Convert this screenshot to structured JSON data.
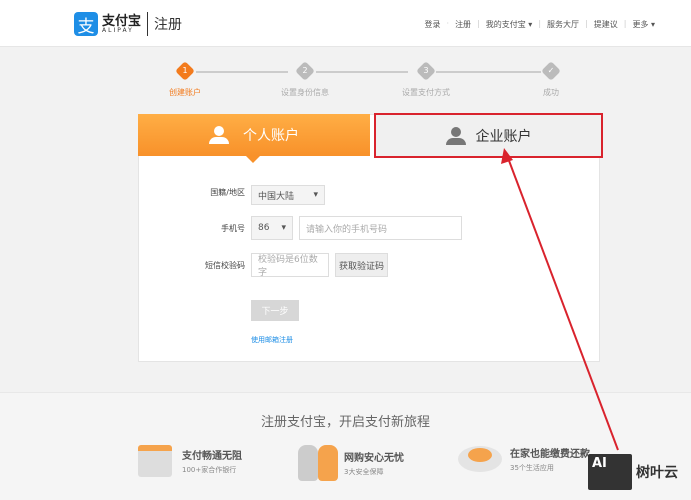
{
  "header": {
    "logo_cn": "支付宝",
    "logo_en": "ALIPAY",
    "page_title": "注册",
    "nav": [
      "登录",
      "注册",
      "我的支付宝",
      "服务大厅",
      "提建议",
      "更多"
    ]
  },
  "steps": [
    {
      "num": "1",
      "label": "创建账户"
    },
    {
      "num": "2",
      "label": "设置身份信息"
    },
    {
      "num": "3",
      "label": "设置支付方式"
    },
    {
      "num": "✓",
      "label": "成功"
    }
  ],
  "tabs": {
    "personal": "个人账户",
    "enterprise": "企业账户"
  },
  "form": {
    "region_label": "国籍/地区",
    "region_value": "中国大陆",
    "phone_label": "手机号",
    "phone_code": "86",
    "phone_placeholder": "请输入你的手机号码",
    "sms_label": "短信校验码",
    "sms_placeholder": "校验码是6位数字",
    "sms_button": "获取验证码",
    "next": "下一步",
    "email_link": "使用邮箱注册"
  },
  "footer": {
    "slogan": "注册支付宝，开启支付新旅程",
    "features": [
      {
        "title": "支付畅通无阻",
        "sub": "100+家合作银行"
      },
      {
        "title": "网购安心无忧",
        "sub": "3大安全保障"
      },
      {
        "title": "在家也能缴费还款",
        "sub": "35个生活应用"
      }
    ]
  },
  "watermark": {
    "logo": "AI",
    "text": "树叶云"
  },
  "colors": {
    "accent": "#f37b1d",
    "link": "#1e8ee6",
    "highlight": "#d9232d"
  }
}
